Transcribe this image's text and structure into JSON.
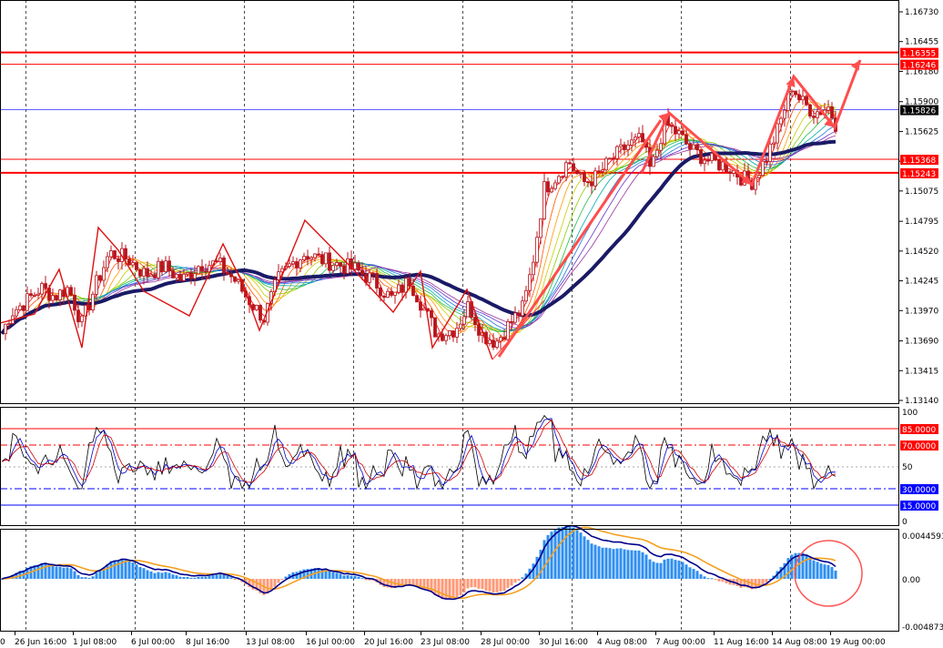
{
  "colors": {
    "background": "#ffffff",
    "grid": "#000000",
    "candle": "#b8141c",
    "ribbon_slow": "#1a1a66",
    "resistance": "#ff0000",
    "current_price": "#2b2bff",
    "drawing": "#ff4d4d",
    "histogram_positive": "#2f8ff0",
    "histogram_negative": "#ff9977",
    "signal": "#f4a020",
    "macd": "#00008b"
  },
  "main_panel": {
    "price_labels": [
      "1.16730",
      "1.16455",
      "1.16180",
      "1.15900",
      "1.15625",
      "1.15350",
      "1.15075",
      "1.14795",
      "1.14520",
      "1.14245",
      "1.13970",
      "1.13690",
      "1.13415",
      "1.13140"
    ],
    "hlines": [
      {
        "label": "1.16355",
        "price": 1.16355,
        "type": "resistance"
      },
      {
        "label": "1.16246",
        "price": 1.16246,
        "type": "resistance"
      },
      {
        "label": "1.15826",
        "price": 1.15826,
        "type": "current"
      },
      {
        "label": "1.15368",
        "price": 1.15368,
        "type": "resistance"
      },
      {
        "label": "1.15243",
        "price": 1.15243,
        "type": "resistance"
      }
    ]
  },
  "oscillator_panel": {
    "top_label": "100",
    "bottom_label": "0",
    "mid_label": "50",
    "levels": [
      {
        "label": "85.0000",
        "value": 85,
        "color": "#ff0000",
        "style": "solid"
      },
      {
        "label": "70.0000",
        "value": 70,
        "color": "#ff0000",
        "style": "dashdot"
      },
      {
        "label": "30.0000",
        "value": 30,
        "color": "#0000ff",
        "style": "dashdot"
      },
      {
        "label": "15.0000",
        "value": 15,
        "color": "#0000ff",
        "style": "solid"
      }
    ]
  },
  "macd_panel": {
    "labels": [
      "0.0044593",
      "0.00",
      "-0.004873"
    ]
  },
  "time_axis": [
    "0",
    "26 Jun 16:00",
    "1 Jul 08:00",
    "6 Jul 00:00",
    "8 Jul 16:00",
    "13 Jul 08:00",
    "16 Jul 00:00",
    "20 Jul 16:00",
    "23 Jul 08:00",
    "28 Jul 00:00",
    "30 Jul 16:00",
    "4 Aug 08:00",
    "7 Aug 00:00",
    "11 Aug 16:00",
    "14 Aug 08:00",
    "19 Aug 00:00"
  ]
}
